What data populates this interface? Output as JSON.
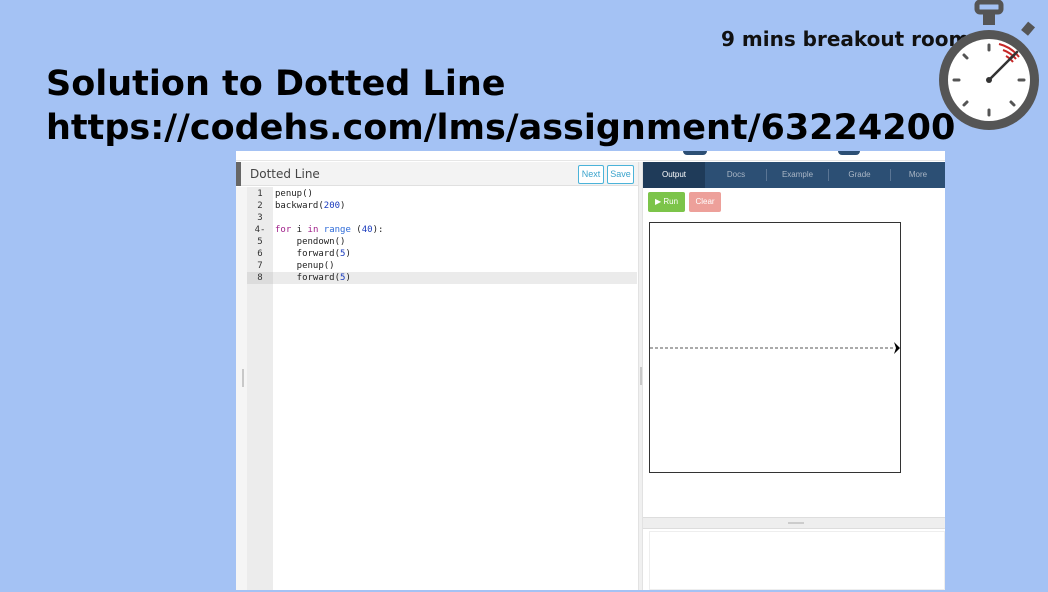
{
  "slide": {
    "timer_label": "9 mins breakout room",
    "title_line1": "Solution to  Dotted Line",
    "title_line2": "https://codehs.com/lms/assignment/63224200",
    "background_color": "#a4c2f4"
  },
  "stopwatch": {
    "icon": "stopwatch-icon"
  },
  "editor": {
    "title": "Dotted Line",
    "next_label": "Next",
    "save_label": "Save",
    "line_numbers": [
      "1",
      "2",
      "3",
      "4",
      "5",
      "6",
      "7",
      "8"
    ],
    "fold_marker": "-",
    "code": {
      "l1": "penup()",
      "l2a": "backward(",
      "l2b": "200",
      "l2c": ")",
      "l4a": "for",
      "l4b": " i ",
      "l4c": "in",
      "l4d": " ",
      "l4e": "range",
      "l4f": " (",
      "l4g": "40",
      "l4h": "):",
      "l5": "    pendown()",
      "l6a": "    forward(",
      "l6b": "5",
      "l6c": ")",
      "l7": "    penup()",
      "l8a": "    forward(",
      "l8b": "5",
      "l8c": ")"
    },
    "active_line": 8
  },
  "output_panel": {
    "tabs": [
      "Output",
      "Docs",
      "Example",
      "Grade",
      "More"
    ],
    "active_tab": "Output",
    "run_label": "▶ Run",
    "clear_label": "Clear",
    "colors": {
      "tab_bar": "#2c4f74",
      "run": "#7cc44a",
      "clear": "#eda09a"
    }
  }
}
